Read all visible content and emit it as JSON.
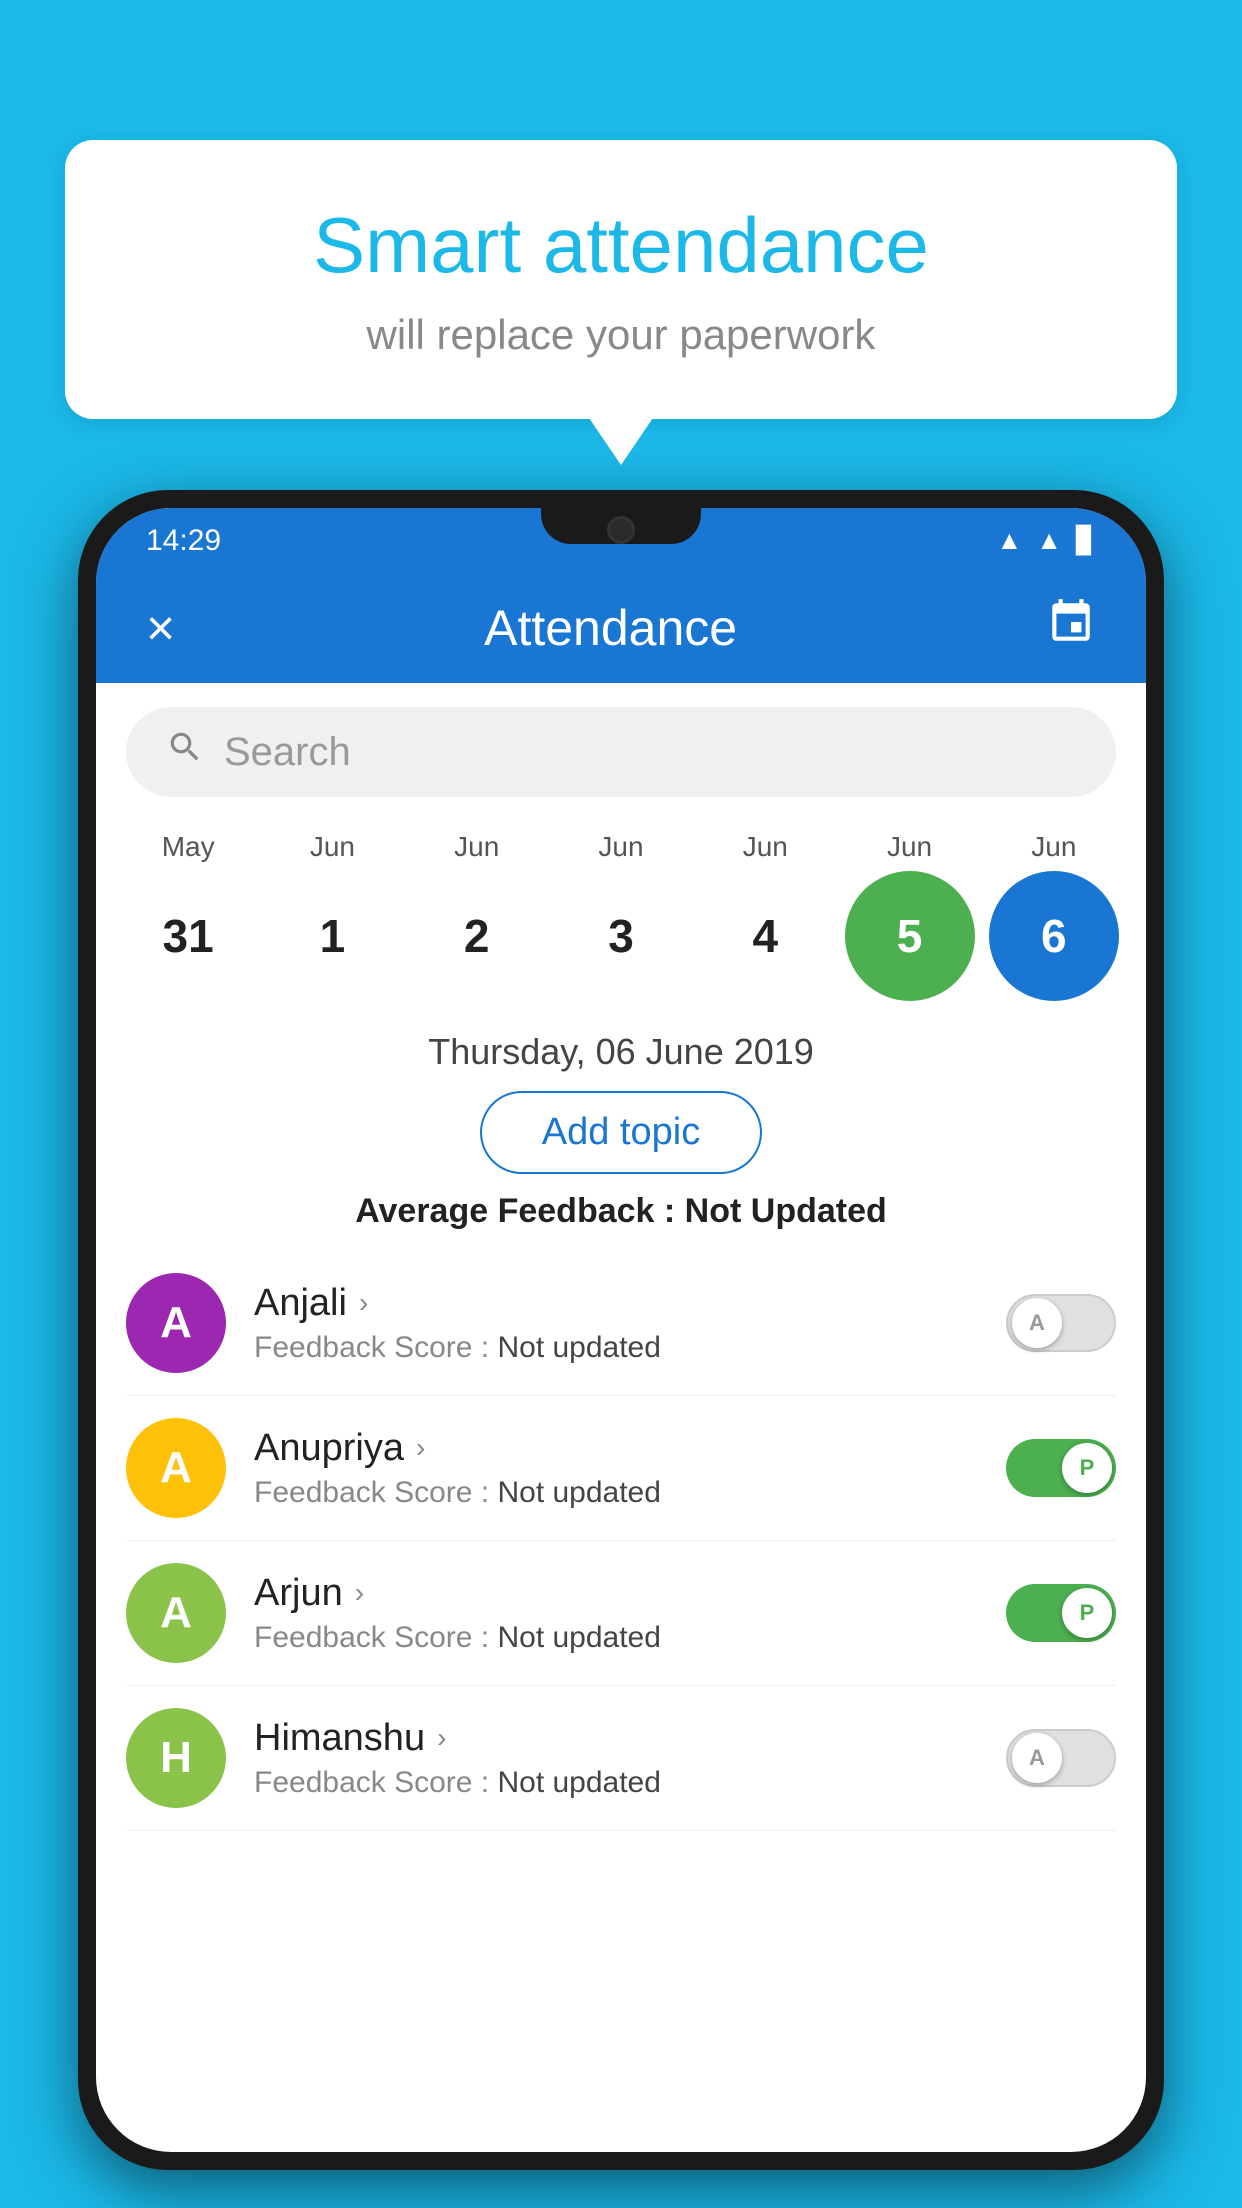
{
  "background": {
    "color": "#1BB8E8"
  },
  "bubble": {
    "title": "Smart attendance",
    "subtitle": "will replace your paperwork"
  },
  "status_bar": {
    "time": "14:29",
    "icons": [
      "wifi",
      "signal",
      "battery"
    ]
  },
  "app_bar": {
    "title": "Attendance",
    "close_label": "×",
    "calendar_label": "📅"
  },
  "search": {
    "placeholder": "Search"
  },
  "calendar": {
    "months": [
      "May",
      "Jun",
      "Jun",
      "Jun",
      "Jun",
      "Jun",
      "Jun"
    ],
    "days": [
      "31",
      "1",
      "2",
      "3",
      "4",
      "5",
      "6"
    ],
    "today_index": 5,
    "selected_index": 6
  },
  "selected_date": "Thursday, 06 June 2019",
  "add_topic_label": "Add topic",
  "avg_feedback_label": "Average Feedback : ",
  "avg_feedback_value": "Not Updated",
  "students": [
    {
      "name": "Anjali",
      "avatar_letter": "A",
      "avatar_color": "#9C27B0",
      "feedback_label": "Feedback Score : ",
      "feedback_value": "Not updated",
      "status": "absent",
      "toggle_letter": "A"
    },
    {
      "name": "Anupriya",
      "avatar_letter": "A",
      "avatar_color": "#FFC107",
      "feedback_label": "Feedback Score : ",
      "feedback_value": "Not updated",
      "status": "present",
      "toggle_letter": "P"
    },
    {
      "name": "Arjun",
      "avatar_letter": "A",
      "avatar_color": "#8BC34A",
      "feedback_label": "Feedback Score : ",
      "feedback_value": "Not updated",
      "status": "present",
      "toggle_letter": "P"
    },
    {
      "name": "Himanshu",
      "avatar_letter": "H",
      "avatar_color": "#8BC34A",
      "feedback_label": "Feedback Score : ",
      "feedback_value": "Not updated",
      "status": "absent",
      "toggle_letter": "A"
    }
  ]
}
